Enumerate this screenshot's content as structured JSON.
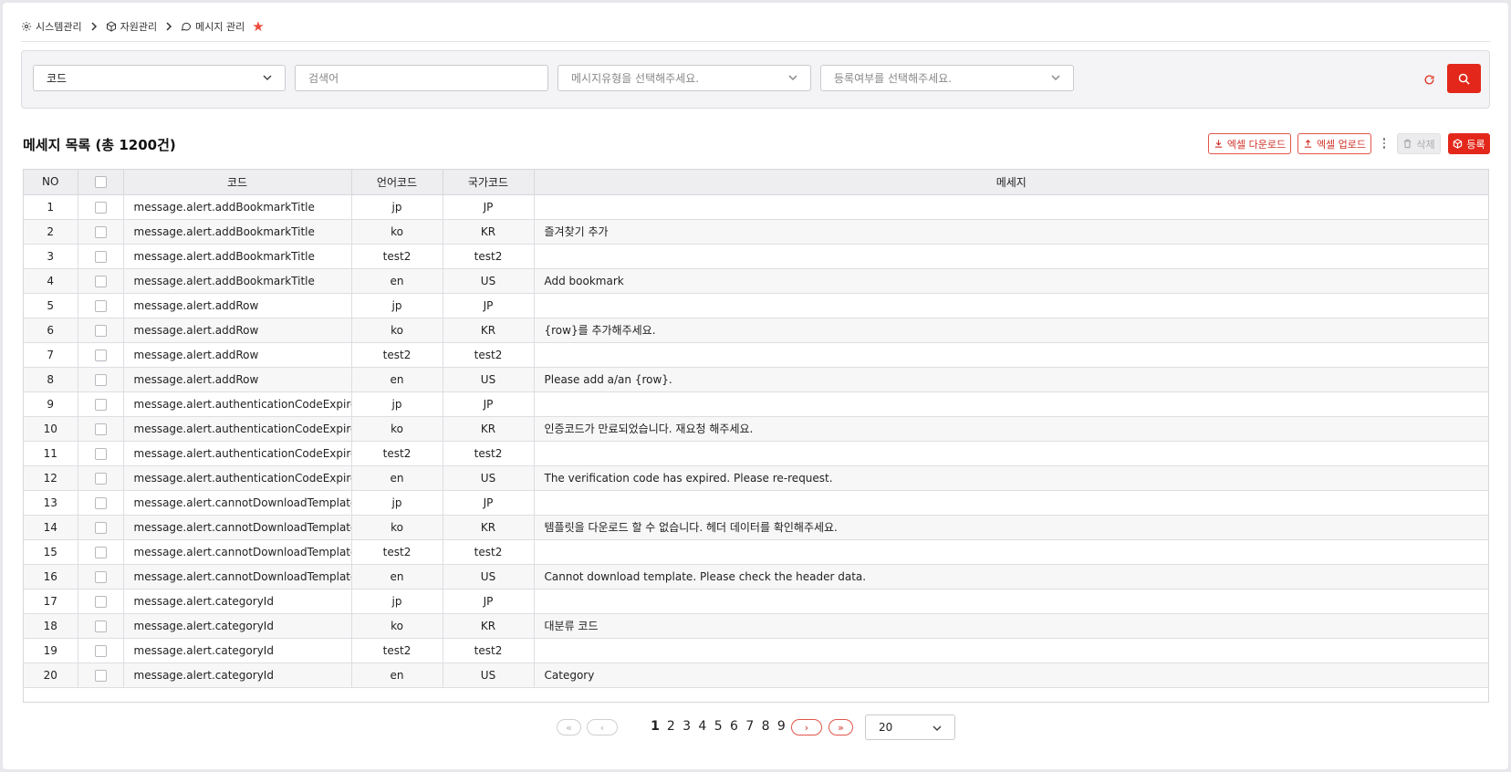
{
  "breadcrumb": [
    {
      "label": "시스템관리",
      "icon": "gear-icon"
    },
    {
      "label": "자원관리",
      "icon": "cube-icon"
    },
    {
      "label": "메시지 관리",
      "icon": "chat-icon"
    }
  ],
  "search": {
    "code_select_value": "코드",
    "keyword_placeholder": "검색어",
    "type_select_placeholder": "메시지유형을 선택해주세요.",
    "reg_select_placeholder": "등록여부를 선택해주세요."
  },
  "list": {
    "title": "메세지 목록 (총 1200건)",
    "excel_download": "엑셀 다운로드",
    "excel_upload": "엑셀 업로드",
    "delete": "삭제",
    "register": "등록"
  },
  "table": {
    "columns": [
      "NO",
      "",
      "코드",
      "언어코드",
      "국가코드",
      "메세지"
    ],
    "rows": [
      {
        "no": "1",
        "code": "message.alert.addBookmarkTitle",
        "lang": "jp",
        "country": "JP",
        "message": ""
      },
      {
        "no": "2",
        "code": "message.alert.addBookmarkTitle",
        "lang": "ko",
        "country": "KR",
        "message": "즐겨찾기 추가"
      },
      {
        "no": "3",
        "code": "message.alert.addBookmarkTitle",
        "lang": "test2",
        "country": "test2",
        "message": ""
      },
      {
        "no": "4",
        "code": "message.alert.addBookmarkTitle",
        "lang": "en",
        "country": "US",
        "message": "Add bookmark"
      },
      {
        "no": "5",
        "code": "message.alert.addRow",
        "lang": "jp",
        "country": "JP",
        "message": ""
      },
      {
        "no": "6",
        "code": "message.alert.addRow",
        "lang": "ko",
        "country": "KR",
        "message": "{row}를 추가해주세요."
      },
      {
        "no": "7",
        "code": "message.alert.addRow",
        "lang": "test2",
        "country": "test2",
        "message": ""
      },
      {
        "no": "8",
        "code": "message.alert.addRow",
        "lang": "en",
        "country": "US",
        "message": "Please add a/an {row}."
      },
      {
        "no": "9",
        "code": "message.alert.authenticationCodeExpires",
        "lang": "jp",
        "country": "JP",
        "message": ""
      },
      {
        "no": "10",
        "code": "message.alert.authenticationCodeExpires",
        "lang": "ko",
        "country": "KR",
        "message": "인증코드가 만료되었습니다. 재요청 해주세요."
      },
      {
        "no": "11",
        "code": "message.alert.authenticationCodeExpires",
        "lang": "test2",
        "country": "test2",
        "message": ""
      },
      {
        "no": "12",
        "code": "message.alert.authenticationCodeExpires",
        "lang": "en",
        "country": "US",
        "message": "The verification code has expired. Please re-request."
      },
      {
        "no": "13",
        "code": "message.alert.cannotDownloadTemplate",
        "lang": "jp",
        "country": "JP",
        "message": ""
      },
      {
        "no": "14",
        "code": "message.alert.cannotDownloadTemplate",
        "lang": "ko",
        "country": "KR",
        "message": "템플릿을 다운로드 할 수 없습니다. 헤더 데이터를 확인해주세요."
      },
      {
        "no": "15",
        "code": "message.alert.cannotDownloadTemplate",
        "lang": "test2",
        "country": "test2",
        "message": ""
      },
      {
        "no": "16",
        "code": "message.alert.cannotDownloadTemplate",
        "lang": "en",
        "country": "US",
        "message": "Cannot download template. Please check the header data."
      },
      {
        "no": "17",
        "code": "message.alert.categoryId",
        "lang": "jp",
        "country": "JP",
        "message": ""
      },
      {
        "no": "18",
        "code": "message.alert.categoryId",
        "lang": "ko",
        "country": "KR",
        "message": "대분류 코드"
      },
      {
        "no": "19",
        "code": "message.alert.categoryId",
        "lang": "test2",
        "country": "test2",
        "message": ""
      },
      {
        "no": "20",
        "code": "message.alert.categoryId",
        "lang": "en",
        "country": "US",
        "message": "Category"
      }
    ]
  },
  "pagination": {
    "pages": [
      "1",
      "2",
      "3",
      "4",
      "5",
      "6",
      "7",
      "8",
      "9"
    ],
    "current": "1",
    "first": "«",
    "prev": "‹",
    "next": "›",
    "last": "»",
    "page_size": "20"
  },
  "colors": {
    "accent": "#e3281b",
    "star": "#ee4a3c"
  }
}
